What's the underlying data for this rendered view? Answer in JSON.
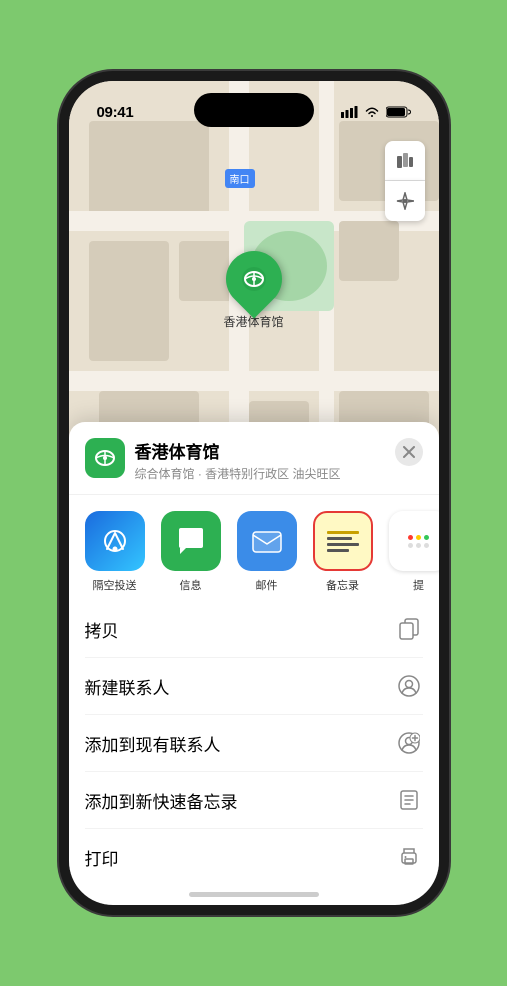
{
  "status": {
    "time": "09:41",
    "location_arrow": true
  },
  "map": {
    "venue_label": "南口",
    "pin_label": "香港体育馆",
    "controls": {
      "map_icon": "map-icon",
      "location_icon": "location-icon"
    }
  },
  "venue_card": {
    "title": "香港体育馆",
    "subtitle": "综合体育馆 · 香港特别行政区 油尖旺区",
    "close_label": "×"
  },
  "share_row": [
    {
      "id": "airdrop",
      "label": "隔空投送",
      "type": "airdrop"
    },
    {
      "id": "messages",
      "label": "信息",
      "type": "messages"
    },
    {
      "id": "mail",
      "label": "邮件",
      "type": "mail"
    },
    {
      "id": "notes",
      "label": "备忘录",
      "type": "notes"
    },
    {
      "id": "more",
      "label": "提",
      "type": "more"
    }
  ],
  "actions": [
    {
      "id": "copy",
      "label": "拷贝",
      "icon": "copy-icon"
    },
    {
      "id": "new-contact",
      "label": "新建联系人",
      "icon": "new-contact-icon"
    },
    {
      "id": "add-existing",
      "label": "添加到现有联系人",
      "icon": "add-contact-icon"
    },
    {
      "id": "add-notes",
      "label": "添加到新快速备忘录",
      "icon": "notes-icon"
    },
    {
      "id": "print",
      "label": "打印",
      "icon": "print-icon"
    }
  ]
}
